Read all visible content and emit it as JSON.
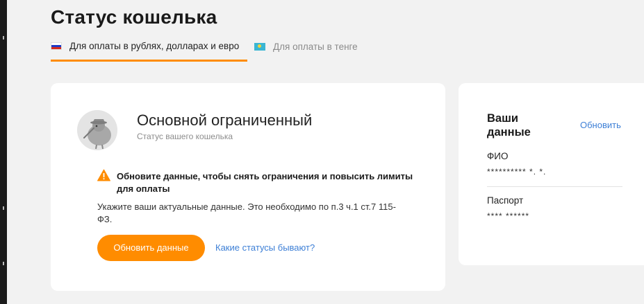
{
  "page": {
    "title": "Статус кошелька"
  },
  "tabs": [
    {
      "label": "Для оплаты в рублях, долларах и евро",
      "flag": "ru-flag-icon",
      "active": true
    },
    {
      "label": "Для оплаты в тенге",
      "flag": "kz-flag-icon",
      "active": false
    }
  ],
  "status": {
    "name": "Основной ограниченный",
    "subtitle": "Статус вашего кошелька",
    "warning": "Обновите данные, чтобы снять ограничения и повысить лимиты для оплаты",
    "info": "Укажите ваши актуальные данные. Это необходимо по п.3 ч.1 ст.7 115-ФЗ.",
    "update_button": "Обновить данные",
    "statuses_link": "Какие статусы бывают?"
  },
  "side": {
    "title": "Ваши данные",
    "refresh": "Обновить",
    "fields": [
      {
        "label": "ФИО",
        "value": "********** *. *."
      },
      {
        "label": "Паспорт",
        "value": "**** ******"
      }
    ]
  },
  "colors": {
    "accent": "#ff8c00",
    "link": "#3d7fd6",
    "background": "#f2f2f2",
    "card": "#ffffff"
  }
}
